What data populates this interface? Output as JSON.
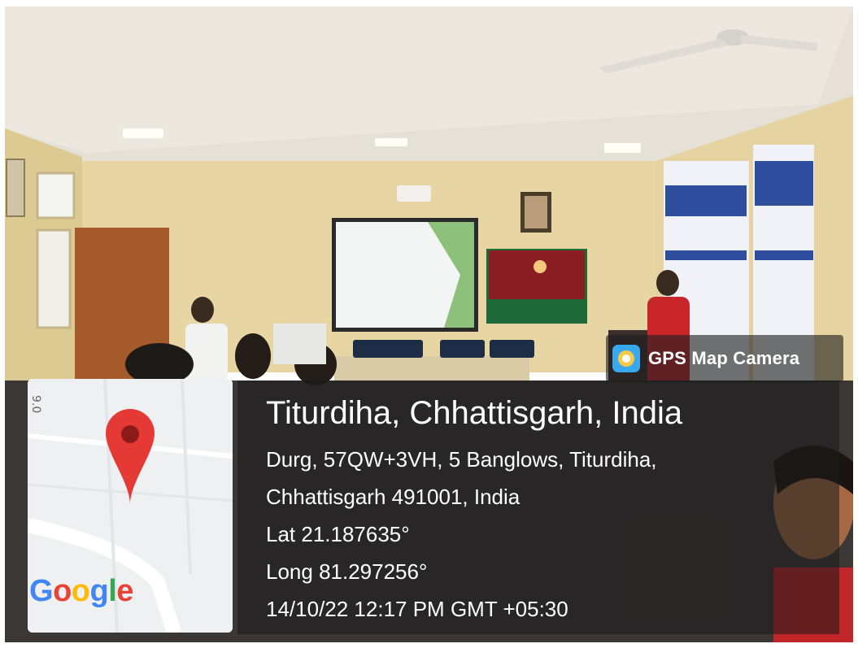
{
  "overlay": {
    "app_name": "GPS Map Camera",
    "place": "Titurdiha, Chhattisgarh, India",
    "address_line1": "Durg, 57QW+3VH, 5 Banglows, Titurdiha,",
    "address_line2": "Chhattisgarh 491001, India",
    "latitude": "Lat 21.187635°",
    "longitude": "Long 81.297256°",
    "datetime": "14/10/22 12:17 PM GMT +05:30",
    "map_logo": {
      "letters": [
        "G",
        "o",
        "o",
        "g",
        "l",
        "e"
      ],
      "colors": [
        "#4285F4",
        "#EA4335",
        "#FBBC05",
        "#4285F4",
        "#34A853",
        "#EA4335"
      ]
    },
    "map_street_label": "9 ...",
    "pin_color": "#E53935"
  },
  "scene": {
    "wall_color": "#e9d8a5",
    "ceiling_color": "#e8e4dc",
    "curtain_colors": [
      "#2f4f9e",
      "#ffffff"
    ],
    "banner_color": "#8a1e23",
    "door_color": "#a45a2a"
  }
}
